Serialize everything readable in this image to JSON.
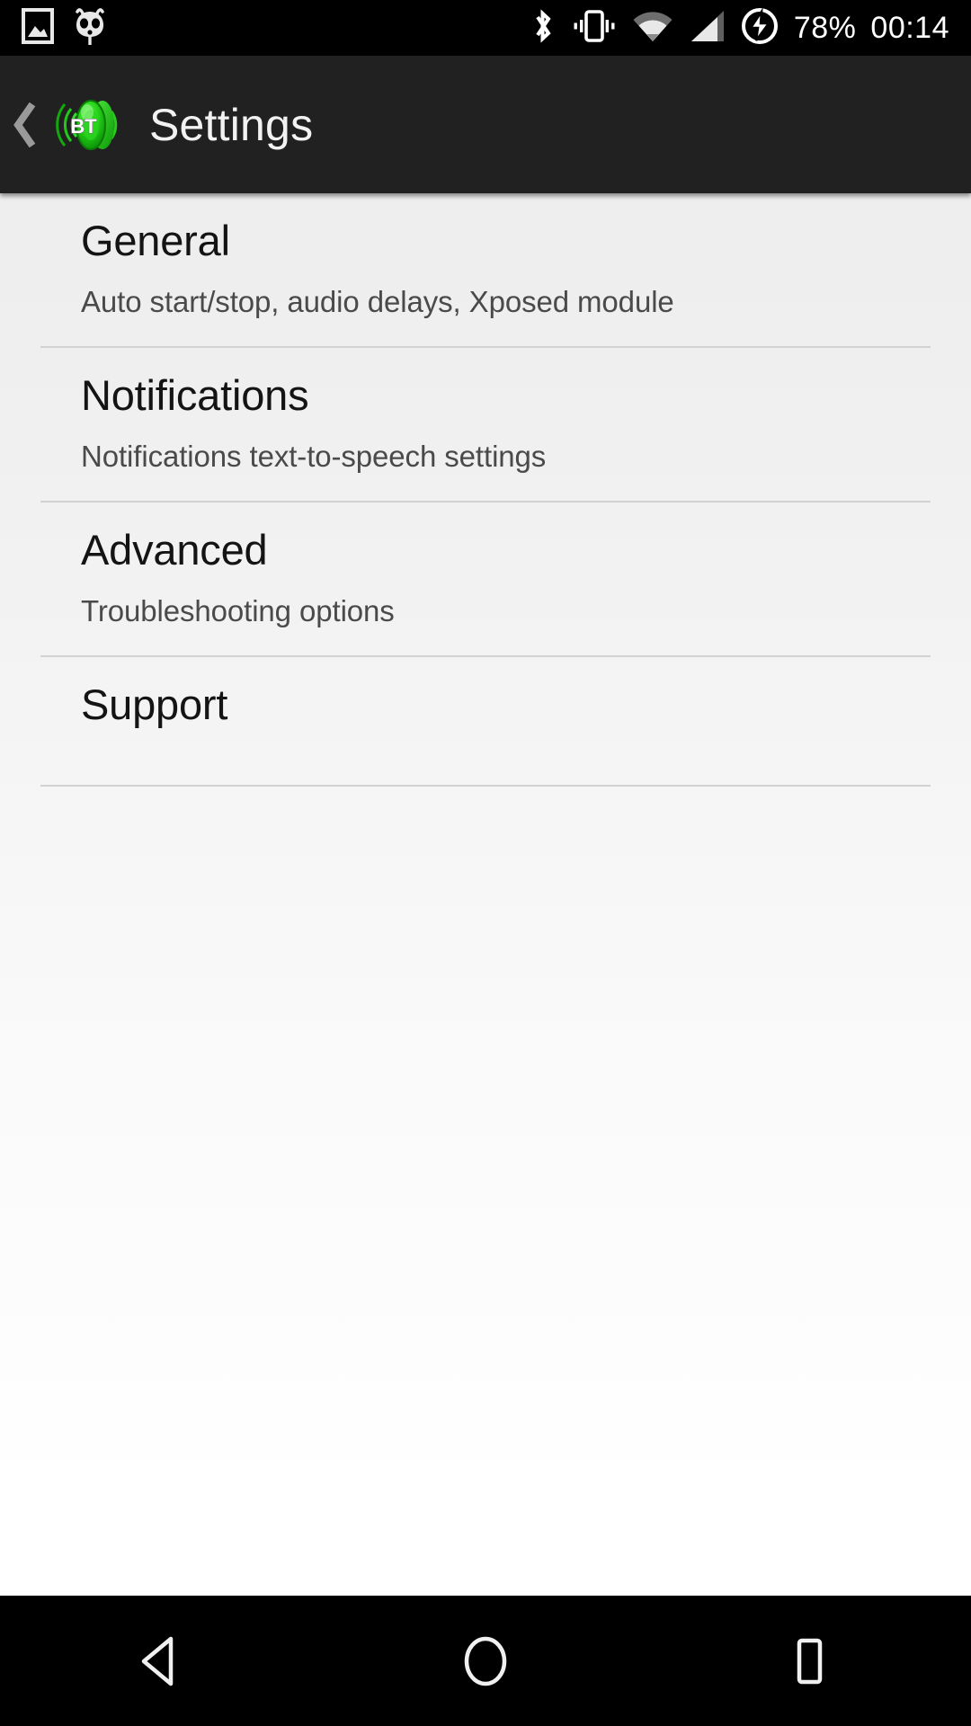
{
  "status_bar": {
    "left_icons": [
      {
        "name": "screenshot-image-icon",
        "label": "screenshot"
      },
      {
        "name": "cyanogenmod-robot-icon",
        "label": "cyanogenmod"
      }
    ],
    "right_icons": [
      {
        "name": "bluetooth-icon",
        "label": "bluetooth"
      },
      {
        "name": "vibrate-icon",
        "label": "vibrate"
      },
      {
        "name": "wifi-icon",
        "label": "wifi"
      },
      {
        "name": "cellular-signal-icon",
        "label": "signal"
      },
      {
        "name": "battery-charging-icon",
        "label": "charging"
      }
    ],
    "battery_percent": "78%",
    "clock": "00:14",
    "background_color": "#000000",
    "text_color": "#ffffff"
  },
  "action_bar": {
    "up_label": "‹",
    "app_icon": "bt-speaker-icon",
    "title": "Settings",
    "background_color": "#212121",
    "title_color": "#f2f2f2",
    "icon_accent_color": "#1fc514"
  },
  "preferences": [
    {
      "title": "General",
      "summary": "Auto start/stop, audio delays, Xposed module",
      "has_divider": true
    },
    {
      "title": "Notifications",
      "summary": "Notifications text-to-speech settings",
      "has_divider": true
    },
    {
      "title": "Advanced",
      "summary": "Troubleshooting options",
      "has_divider": true
    },
    {
      "title": "Support",
      "summary": "",
      "has_divider": true
    }
  ],
  "nav_bar": {
    "buttons": [
      {
        "name": "nav-back-button",
        "label": "back"
      },
      {
        "name": "nav-home-button",
        "label": "home"
      },
      {
        "name": "nav-recents-button",
        "label": "recents"
      }
    ],
    "background_color": "#000000"
  },
  "content": {
    "background_top_color": "#eeeeee",
    "background_bottom_color": "#ffffff",
    "divider_color": "#d2d2d2",
    "title_color": "#141414",
    "summary_color": "#4a4a4a"
  }
}
